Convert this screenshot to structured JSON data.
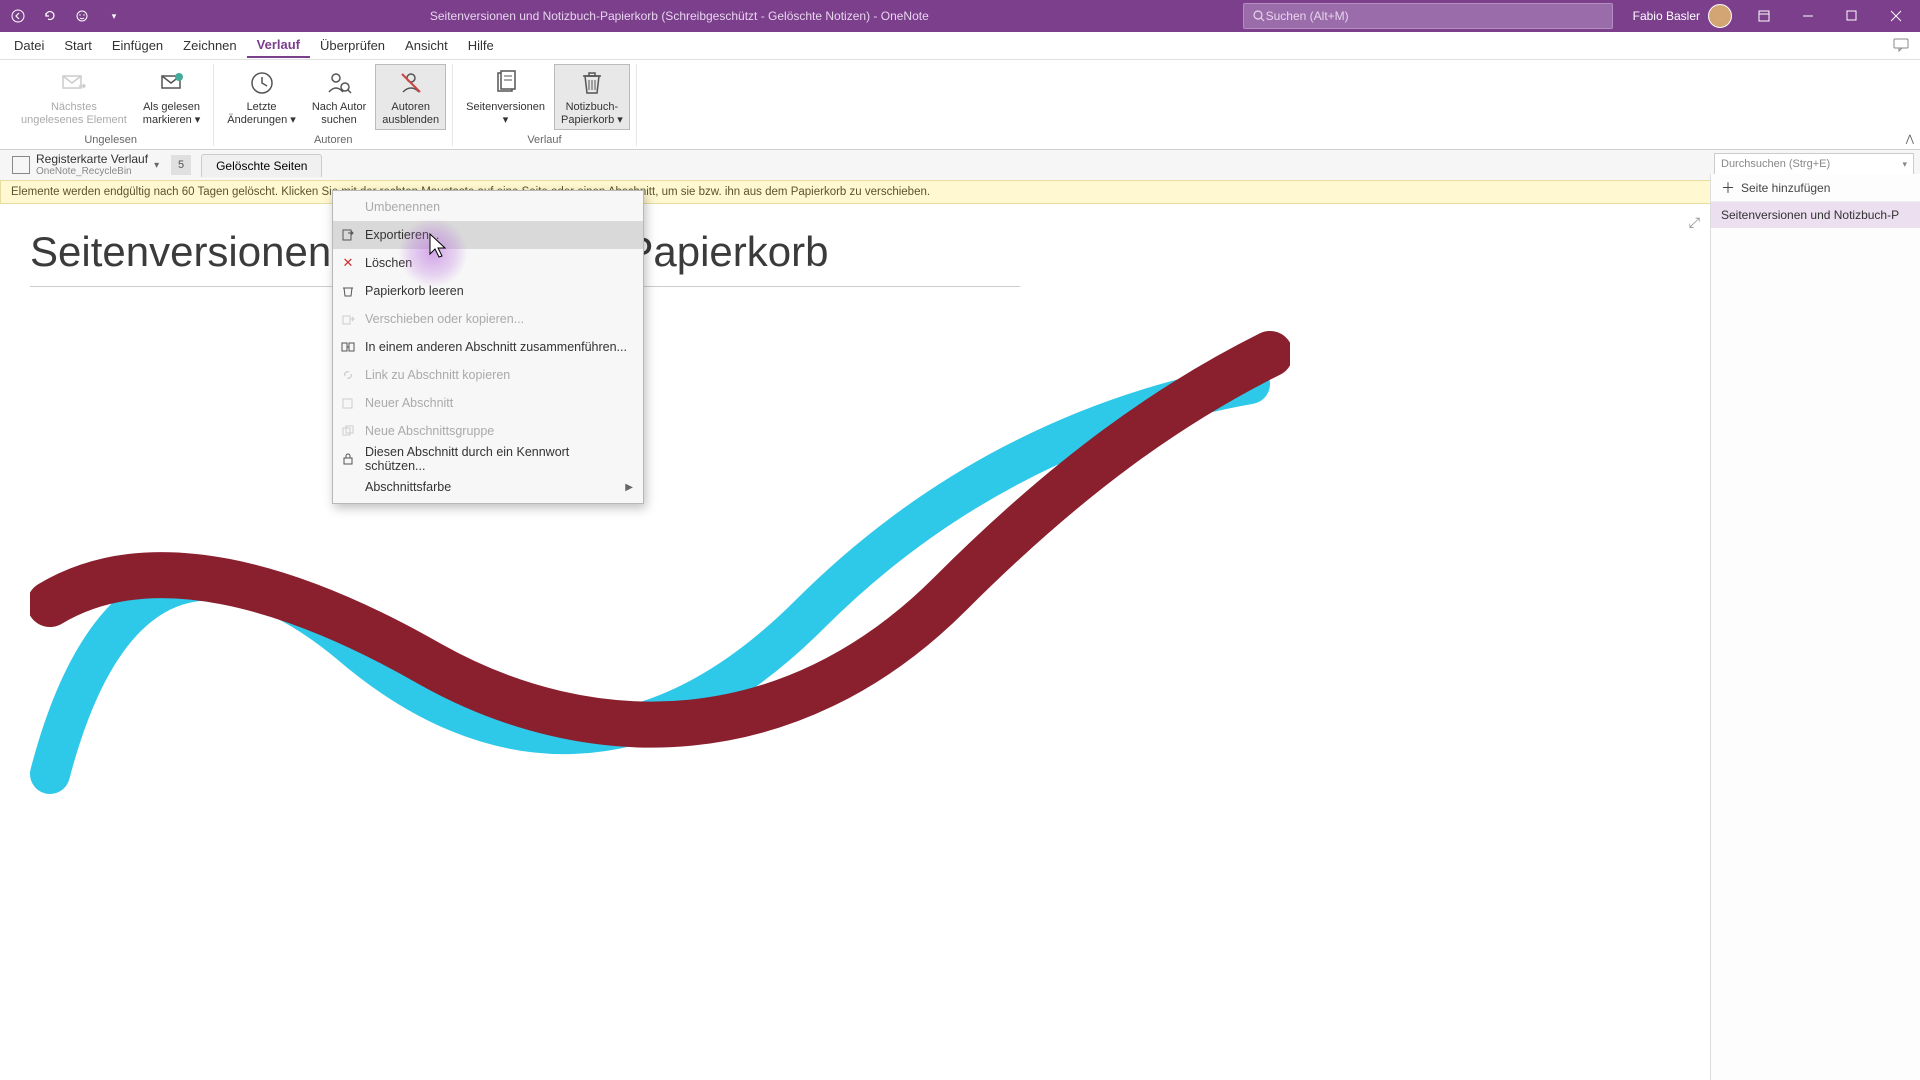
{
  "titlebar": {
    "title": "Seitenversionen und Notizbuch-Papierkorb (Schreibgeschützt - Gelöschte Notizen)  -  OneNote",
    "search_placeholder": "Suchen (Alt+M)",
    "user": "Fabio Basler"
  },
  "menubar": {
    "items": [
      "Datei",
      "Start",
      "Einfügen",
      "Zeichnen",
      "Verlauf",
      "Überprüfen",
      "Ansicht",
      "Hilfe"
    ],
    "active_index": 4
  },
  "ribbon": {
    "groups": [
      {
        "label": "Ungelesen",
        "buttons": [
          {
            "label": "Nächstes\nungelesenes Element",
            "disabled": true,
            "icon": "mail-next"
          },
          {
            "label": "Als gelesen\nmarkieren ▾",
            "disabled": false,
            "icon": "mark-read"
          }
        ]
      },
      {
        "label": "Autoren",
        "buttons": [
          {
            "label": "Letzte\nÄnderungen ▾",
            "icon": "clock"
          },
          {
            "label": "Nach Autor\nsuchen",
            "icon": "author-search"
          },
          {
            "label": "Autoren\nausblenden",
            "icon": "author-hide",
            "selected": true
          }
        ]
      },
      {
        "label": "Verlauf",
        "buttons": [
          {
            "label": "Seitenversionen\n▾",
            "icon": "page-versions"
          },
          {
            "label": "Notizbuch-\nPapierkorb ▾",
            "icon": "trash",
            "selected": true
          }
        ]
      }
    ]
  },
  "subtabs": {
    "notebook_title": "Registerkarte Verlauf",
    "notebook_sub": "OneNote_RecycleBin",
    "page_num": "5",
    "section_tab": "Gelöschte Seiten",
    "search_placeholder": "Durchsuchen (Strg+E)"
  },
  "infobar": {
    "text": "Elemente werden endgültig nach 60 Tagen gelöscht. Klicken Sie mit der rechten Maustaste auf eine Seite oder einen Abschnitt, um sie bzw. ihn aus dem Papierkorb zu verschieben."
  },
  "page": {
    "title": "Seitenversionen und Notizbuch-Papierkorb"
  },
  "right_pane": {
    "add_page": "Seite hinzufügen",
    "pages": [
      "Seitenversionen und Notizbuch-P"
    ]
  },
  "context_menu": {
    "items": [
      {
        "label": "Umbenennen",
        "icon": "",
        "disabled": true
      },
      {
        "label": "Exportieren...",
        "icon": "export",
        "disabled": false,
        "hover": true
      },
      {
        "label": "Löschen",
        "icon": "delete-x",
        "disabled": false
      },
      {
        "label": "Papierkorb leeren",
        "icon": "trash-empty",
        "disabled": false
      },
      {
        "label": "Verschieben oder kopieren...",
        "icon": "move",
        "disabled": true
      },
      {
        "label": "In einem anderen Abschnitt zusammenführen...",
        "icon": "merge",
        "disabled": false
      },
      {
        "label": "Link zu Abschnitt kopieren",
        "icon": "link",
        "disabled": true
      },
      {
        "label": "Neuer Abschnitt",
        "icon": "section",
        "disabled": true
      },
      {
        "label": "Neue Abschnittsgruppe",
        "icon": "section-group",
        "disabled": true
      },
      {
        "label": "Diesen Abschnitt durch ein Kennwort schützen...",
        "icon": "lock",
        "disabled": false
      },
      {
        "label": "Abschnittsfarbe",
        "icon": "",
        "disabled": false,
        "submenu": true
      }
    ]
  }
}
